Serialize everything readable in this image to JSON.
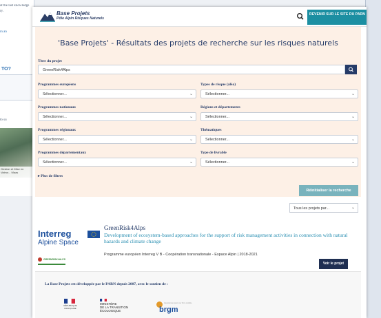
{
  "background": {
    "lines": [
      "at the last knowledge",
      "ry.",
      "in an",
      "TO?",
      "to su",
      "y"
    ],
    "photo_caption": "Gestion et Mise en Valeur... Maas"
  },
  "header": {
    "logo_title": "Base Projets",
    "logo_subtitle": "Pôle Alpin Risques Naturels",
    "back_label": "REVENIR SUR LE SITE DU PARN"
  },
  "page_title": "'Base Projets' - Résultats des projets de recherche sur les risques naturels",
  "search": {
    "label": "Titre du projet",
    "value": "GreenRisk4Alps"
  },
  "filters": [
    {
      "label": "Programmes européens",
      "value": "Sélectionner..."
    },
    {
      "label": "Types de risque (aléa)",
      "value": "Sélectionner..."
    },
    {
      "label": "Programmes nationaux",
      "value": "Sélectionner..."
    },
    {
      "label": "Régions et départements",
      "value": "Sélectionner..."
    },
    {
      "label": "Programmes régionaux",
      "value": "Sélectionner..."
    },
    {
      "label": "Thématiques",
      "value": "Sélectionner..."
    },
    {
      "label": "Programmes départementaux",
      "value": "Sélectionner..."
    },
    {
      "label": "Type de livrable",
      "value": "Sélectionner..."
    }
  ],
  "more_filters": "Plus de filtres",
  "reset_label": "Réinitialiser la recherche",
  "sort": {
    "value": "Tous les projets par..."
  },
  "result": {
    "logo_text": "Interreg",
    "logo_sub": "Alpine Space",
    "badge": "GREENRISK4ALPS",
    "title": "GreenRisk4Alps",
    "description": "Development of ecosystem-based approaches for the support of risk management activities in connection with natural hazards and climate change",
    "programme": "Programme européen Interreg V B - Coopération transnationale - Espace Alpin | 2018-2021",
    "view_label": "Voir le projet"
  },
  "footer": {
    "text": "La Base Projets est développée par le PARN depuis 2007, avec le soutien de :",
    "rf_text": "RÉPUBLIQUE FRANÇAISE",
    "ministry": "MINISTÈRE\nDE LA TRANSITION\nÉCOLOGIQUE",
    "brgm": "brgm",
    "brgm_small": "Géosciences pour une Terre durable"
  },
  "colors": {
    "accent": "#1c8fa2",
    "navy": "#253b68",
    "filter_bg": "#fdf0e6",
    "reset": "#79b3bd"
  }
}
